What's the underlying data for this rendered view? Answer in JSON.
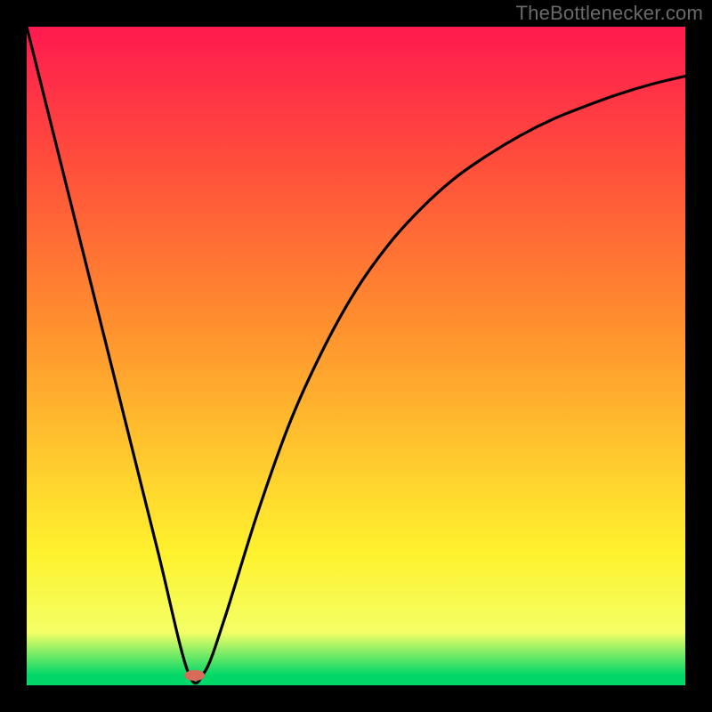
{
  "watermark": "TheBottlenecker.com",
  "colors": {
    "gradient_top": "#ff1a4f",
    "gradient_upper": "#ff4c3c",
    "gradient_mid_upper": "#ff8f2e",
    "gradient_mid": "#ffc82e",
    "gradient_mid_lower": "#fff22e",
    "gradient_lower": "#f3ff66",
    "gradient_green": "#00d768",
    "curve": "#000000",
    "marker_fill": "#d86a5a",
    "frame": "#000000"
  },
  "chart_data": {
    "type": "line",
    "title": "",
    "xlabel": "",
    "ylabel": "",
    "xlim": [
      0,
      100
    ],
    "ylim": [
      0,
      100
    ],
    "legend": false,
    "grid": false,
    "series": [
      {
        "name": "bottleneck-curve",
        "x": [
          0,
          5,
          10,
          15,
          20,
          24.5,
          27,
          30,
          35,
          40,
          45,
          50,
          55,
          60,
          65,
          70,
          75,
          80,
          85,
          90,
          95,
          100
        ],
        "y": [
          100,
          80,
          60,
          40,
          20,
          2,
          2,
          10,
          26,
          40,
          51,
          60,
          67,
          72.5,
          77,
          80.5,
          83.5,
          86,
          88,
          89.8,
          91.3,
          92.5
        ]
      }
    ],
    "markers": [
      {
        "name": "optimal-point",
        "x": 25.5,
        "y": 1.5
      }
    ],
    "background_gradient": {
      "direction": "vertical",
      "stops": [
        {
          "offset": 0.0,
          "key": "gradient_top"
        },
        {
          "offset": 0.2,
          "key": "gradient_upper"
        },
        {
          "offset": 0.45,
          "key": "gradient_mid_upper"
        },
        {
          "offset": 0.65,
          "key": "gradient_mid"
        },
        {
          "offset": 0.8,
          "key": "gradient_mid_lower"
        },
        {
          "offset": 0.92,
          "key": "gradient_lower"
        },
        {
          "offset": 0.985,
          "key": "gradient_green"
        },
        {
          "offset": 1.0,
          "key": "gradient_green"
        }
      ]
    }
  }
}
